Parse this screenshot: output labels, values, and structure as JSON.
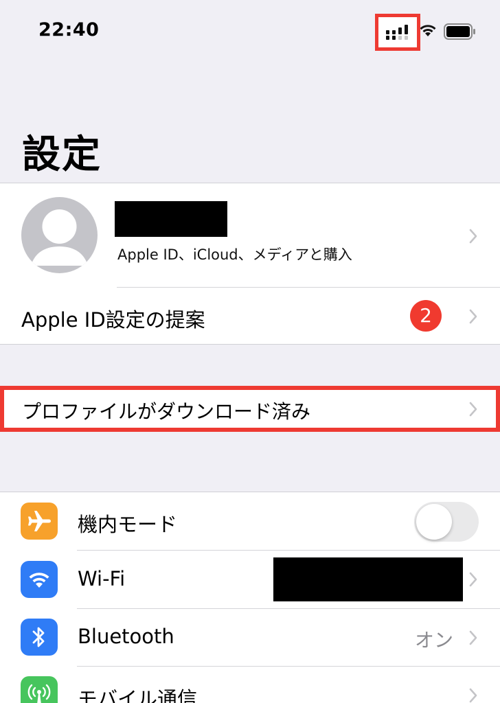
{
  "status_bar": {
    "time": "22:40"
  },
  "page_title": "設定",
  "profile": {
    "subtitle": "Apple ID、iCloud、メディアと購入",
    "suggestion_label": "Apple ID設定の提案",
    "suggestion_badge": "2"
  },
  "profile_download": {
    "label": "プロファイルがダウンロード済み"
  },
  "settings": [
    {
      "label": "機内モード",
      "icon": "airplane-icon",
      "color": "#f7a12b",
      "toggle_on": false
    },
    {
      "label": "Wi-Fi",
      "icon": "wifi-icon",
      "color": "#2f7cf6"
    },
    {
      "label": "Bluetooth",
      "icon": "bluetooth-icon",
      "color": "#2f7cf6",
      "value": "オン"
    },
    {
      "label": "モバイル通信",
      "icon": "cellular-icon",
      "color": "#47c55d"
    }
  ],
  "colors": {
    "highlight": "#ee3a32",
    "badge": "#f03a2f",
    "background": "#f0eff5"
  }
}
